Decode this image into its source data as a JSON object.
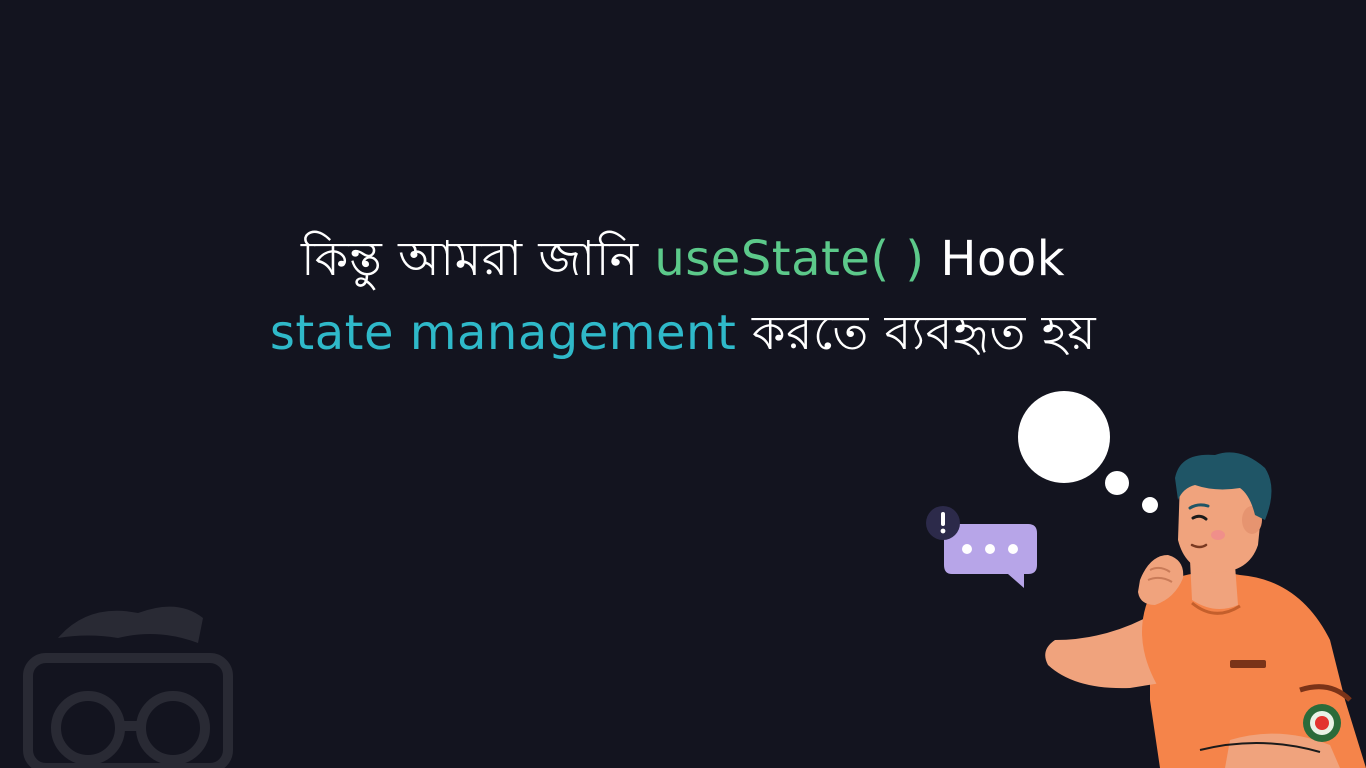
{
  "caption": {
    "line1": {
      "part1": "কিন্তু আমরা জানি",
      "code": "useState( )",
      "part2": "Hook"
    },
    "line2": {
      "term": "state management",
      "part1": "করতে ব্যবহৃত হয়"
    }
  },
  "colors": {
    "background": "#13141f",
    "code_green": "#5cc98a",
    "term_cyan": "#2fb9c9",
    "shirt_orange": "#f5844a",
    "hair": "#1f5566",
    "bubble_purple": "#b7a5e8"
  },
  "icons": {
    "speech_bubble": "chat-dots-icon",
    "alert": "exclamation-icon",
    "thought": "thought-bubble-icon",
    "watermark": "logo-watermark-icon",
    "badge": "record-badge-icon"
  }
}
